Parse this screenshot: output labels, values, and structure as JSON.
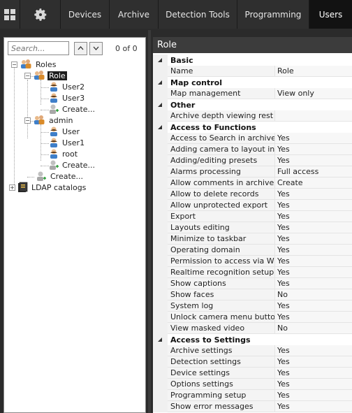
{
  "topnav": {
    "items": [
      {
        "label": "Devices",
        "active": false
      },
      {
        "label": "Archive",
        "active": false
      },
      {
        "label": "Detection Tools",
        "active": false
      },
      {
        "label": "Programming",
        "active": false
      },
      {
        "label": "Users",
        "active": true
      }
    ]
  },
  "left": {
    "search_placeholder": "Search...",
    "count": "0 of 0",
    "tree": {
      "roles": "Roles",
      "role": "Role",
      "user2": "User2",
      "user3": "User3",
      "create1": "Create...",
      "admin": "admin",
      "user": "User",
      "user1": "User1",
      "root": "root",
      "create2": "Create...",
      "create3": "Create...",
      "ldap": "LDAP catalogs"
    }
  },
  "right": {
    "title": "Role",
    "rows": [
      {
        "type": "cat",
        "name": "Basic"
      },
      {
        "type": "prop",
        "name": "Name",
        "value": "Role"
      },
      {
        "type": "cat",
        "name": "Map control"
      },
      {
        "type": "prop",
        "name": "Map management",
        "value": "View only"
      },
      {
        "type": "cat",
        "name": "Other"
      },
      {
        "type": "prop",
        "name": "Archive depth viewing rest",
        "value": ""
      },
      {
        "type": "cat",
        "name": "Access to Functions"
      },
      {
        "type": "prop",
        "name": "Access to Search in archive",
        "value": "Yes"
      },
      {
        "type": "prop",
        "name": "Adding camera to layout in",
        "value": "Yes"
      },
      {
        "type": "prop",
        "name": "Adding/editing presets",
        "value": "Yes"
      },
      {
        "type": "prop",
        "name": "Alarms processing",
        "value": "Full access"
      },
      {
        "type": "prop",
        "name": "Allow comments in archive",
        "value": "Create"
      },
      {
        "type": "prop",
        "name": "Allow to delete records",
        "value": "Yes"
      },
      {
        "type": "prop",
        "name": "Allow unprotected export",
        "value": "Yes"
      },
      {
        "type": "prop",
        "name": "Export",
        "value": "Yes"
      },
      {
        "type": "prop",
        "name": "Layouts editing",
        "value": "Yes"
      },
      {
        "type": "prop",
        "name": "Minimize to taskbar",
        "value": "Yes"
      },
      {
        "type": "prop",
        "name": "Operating domain",
        "value": "Yes"
      },
      {
        "type": "prop",
        "name": "Permission to access via W",
        "value": "Yes"
      },
      {
        "type": "prop",
        "name": "Realtime recognition setup",
        "value": "Yes"
      },
      {
        "type": "prop",
        "name": "Show captions",
        "value": "Yes"
      },
      {
        "type": "prop",
        "name": "Show faces",
        "value": "No"
      },
      {
        "type": "prop",
        "name": "System log",
        "value": "Yes"
      },
      {
        "type": "prop",
        "name": "Unlock camera menu butto",
        "value": "Yes"
      },
      {
        "type": "prop",
        "name": "View masked video",
        "value": "No"
      },
      {
        "type": "cat",
        "name": "Access to Settings"
      },
      {
        "type": "prop",
        "name": "Archive settings",
        "value": "Yes"
      },
      {
        "type": "prop",
        "name": "Detection settings",
        "value": "Yes"
      },
      {
        "type": "prop",
        "name": "Device settings",
        "value": "Yes"
      },
      {
        "type": "prop",
        "name": "Options settings",
        "value": "Yes"
      },
      {
        "type": "prop",
        "name": "Programming setup",
        "value": "Yes"
      },
      {
        "type": "prop",
        "name": "Show error messages",
        "value": "Yes"
      }
    ]
  },
  "colors": {
    "topbar": "#2c2c2c",
    "active_tab": "#121212",
    "selected_node": "#1e1e1e",
    "panel_header": "#3c3c3c"
  }
}
